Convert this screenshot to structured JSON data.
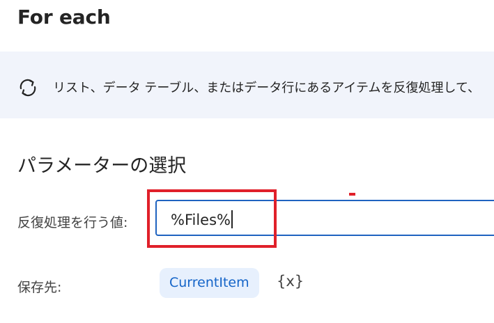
{
  "header": {
    "title": "For each"
  },
  "info": {
    "icon": "loop-icon",
    "text": "リスト、データ テーブル、またはデータ行にあるアイテムを反復処理して、"
  },
  "parameters": {
    "section_title": "パラメーターの選択",
    "iterate_label": "反復処理を行う値:",
    "iterate_value": "%Files%",
    "save_label": "保存先:",
    "save_variable": "CurrentItem",
    "variable_picker": "{x}"
  },
  "colors": {
    "accent": "#1f63c0",
    "highlight": "#e0202a",
    "info_background": "#f1f4fb",
    "chip_background": "#e7f0fd",
    "chip_text": "#1464c8"
  }
}
